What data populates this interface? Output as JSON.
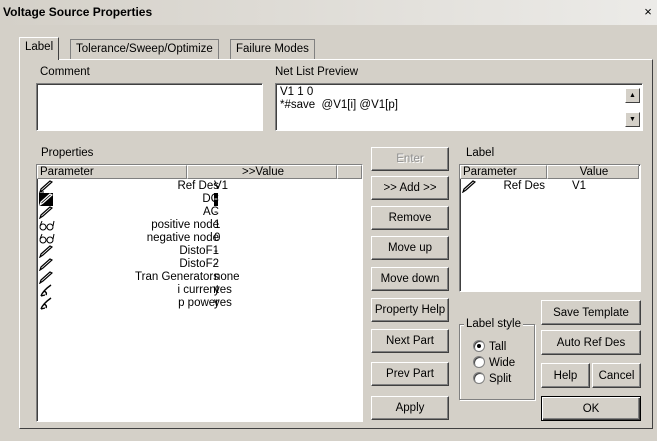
{
  "window": {
    "title": "Voltage Source Properties",
    "close_glyph": "×"
  },
  "tabs": [
    {
      "label": "Label",
      "active": true
    },
    {
      "label": "Tolerance/Sweep/Optimize",
      "active": false
    },
    {
      "label": "Failure Modes",
      "active": false
    }
  ],
  "comment": {
    "label": "Comment",
    "value": ""
  },
  "netlist": {
    "label": "Net List Preview",
    "lines": [
      "V1 1 0",
      "*#save  @V1[i] @V1[p]"
    ]
  },
  "properties": {
    "label": "Properties",
    "col_parameter": "Parameter",
    "col_value": ">>Value",
    "rows": [
      {
        "icon": "pencil-icon",
        "name": "Ref Des",
        "value": "V1"
      },
      {
        "icon": "pencil-selected-icon",
        "name": "DC",
        "value": "-"
      },
      {
        "icon": "pencil-icon",
        "name": "AC",
        "value": "-"
      },
      {
        "icon": "glasses-icon",
        "name": "positive node",
        "value": "1"
      },
      {
        "icon": "glasses-icon",
        "name": "negative node",
        "value": "0"
      },
      {
        "icon": "pencil-icon",
        "name": "DistoF1",
        "value": "-"
      },
      {
        "icon": "pencil-icon",
        "name": "DistoF2",
        "value": "-"
      },
      {
        "icon": "pencil-icon",
        "name": "Tran Generators",
        "value": "none"
      },
      {
        "icon": "script-pen-icon",
        "name": "i current",
        "value": "yes"
      },
      {
        "icon": "script-pen-icon",
        "name": "p power",
        "value": "yes"
      }
    ]
  },
  "label_panel": {
    "label": "Label",
    "col_parameter": "Parameter",
    "col_value": "Value",
    "rows": [
      {
        "icon": "pencil-icon",
        "name": "Ref Des",
        "value": "V1"
      }
    ]
  },
  "buttons": {
    "enter": "Enter",
    "add": ">> Add >>",
    "remove": "Remove",
    "move_up": "Move up",
    "move_down": "Move down",
    "property_help": "Property Help",
    "next_part": "Next Part",
    "prev_part": "Prev Part",
    "apply": "Apply",
    "save_template": "Save Template",
    "auto_ref_des": "Auto Ref Des",
    "help": "Help",
    "cancel": "Cancel",
    "ok": "OK"
  },
  "label_style": {
    "title": "Label style",
    "options": [
      {
        "label": "Tall",
        "checked": true
      },
      {
        "label": "Wide",
        "checked": false
      },
      {
        "label": "Split",
        "checked": false
      }
    ]
  }
}
